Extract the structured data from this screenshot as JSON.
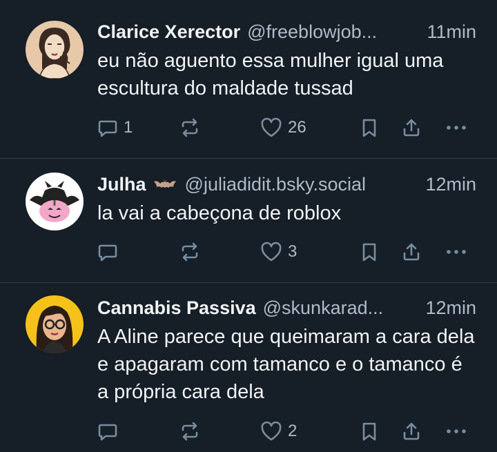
{
  "posts": [
    {
      "name": "Clarice Xerector",
      "handle": "@freeblowjob...",
      "time": "11min",
      "text": "eu não aguento essa mulher igual uma escultura do maldade tussad",
      "reply_count": "1",
      "repost_count": "",
      "like_count": "26",
      "avatar": "woman-sketch-avatar"
    },
    {
      "name": "Julha",
      "handle": "@juliadidit.bsky.social",
      "time": "12min",
      "text": "la vai a cabeçona de roblox",
      "reply_count": "",
      "repost_count": "",
      "like_count": "3",
      "avatar": "pumpkin-bat-avatar",
      "badge": "bat-icon"
    },
    {
      "name": "Cannabis Passiva",
      "handle": "@skunkarad...",
      "time": "12min",
      "text": "A Aline parece que queimaram a cara dela e apagaram com tamanco e o tamanco é a própria cara dela",
      "reply_count": "",
      "repost_count": "",
      "like_count": "2",
      "avatar": "cartoon-woman-glasses-avatar"
    }
  ],
  "colors": {
    "background": "#161e27",
    "divider": "#2e4052",
    "icon": "#788da1",
    "muted_text": "#aebbc9",
    "text": "#f1f3f5"
  }
}
